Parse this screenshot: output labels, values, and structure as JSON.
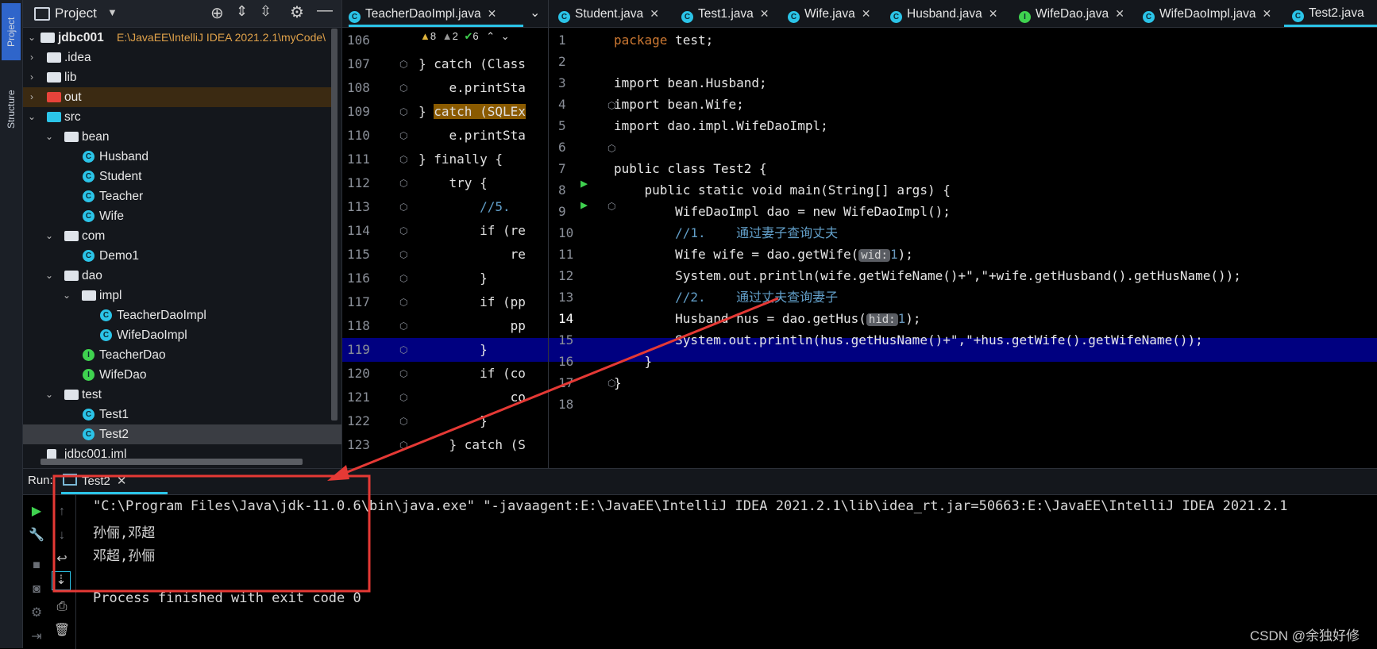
{
  "left_strip": {
    "project_label": "Project",
    "structure_label": "Structure"
  },
  "project": {
    "header_title": "Project",
    "root": {
      "name": "jdbc001",
      "path": "E:\\JavaEE\\IntelliJ IDEA 2021.2.1\\myCode\\"
    },
    "items": [
      {
        "label": ".idea"
      },
      {
        "label": "lib"
      },
      {
        "label": "out"
      },
      {
        "label": "src"
      },
      {
        "label": "bean"
      },
      {
        "label": "Husband"
      },
      {
        "label": "Student"
      },
      {
        "label": "Teacher"
      },
      {
        "label": "Wife"
      },
      {
        "label": "com"
      },
      {
        "label": "Demo1"
      },
      {
        "label": "dao"
      },
      {
        "label": "impl"
      },
      {
        "label": "TeacherDaoImpl"
      },
      {
        "label": "WifeDaoImpl"
      },
      {
        "label": "TeacherDao"
      },
      {
        "label": "WifeDao"
      },
      {
        "label": "test"
      },
      {
        "label": "Test1"
      },
      {
        "label": "Test2"
      },
      {
        "label": "jdbc001.iml"
      }
    ]
  },
  "editor1": {
    "tab": "TeacherDaoImpl.java",
    "inspections": {
      "warnings": "8",
      "weak": "2",
      "ok": "6"
    },
    "lines": [
      {
        "n": "106",
        "code": ""
      },
      {
        "n": "107",
        "code": "} catch (Class"
      },
      {
        "n": "108",
        "code": "    e.printSta"
      },
      {
        "n": "109",
        "code": "} catch (SQLEx"
      },
      {
        "n": "110",
        "code": "    e.printSta"
      },
      {
        "n": "111",
        "code": "} finally {"
      },
      {
        "n": "112",
        "code": "    try {"
      },
      {
        "n": "113",
        "code": "        //5."
      },
      {
        "n": "114",
        "code": "        if (re"
      },
      {
        "n": "115",
        "code": "            re"
      },
      {
        "n": "116",
        "code": "        }"
      },
      {
        "n": "117",
        "code": "        if (pp"
      },
      {
        "n": "118",
        "code": "            pp"
      },
      {
        "n": "119",
        "code": "        }"
      },
      {
        "n": "120",
        "code": "        if (co"
      },
      {
        "n": "121",
        "code": "            co"
      },
      {
        "n": "122",
        "code": "        }"
      },
      {
        "n": "123",
        "code": "    } catch (S"
      }
    ]
  },
  "editor2": {
    "tabs": [
      "Student.java",
      "Test1.java",
      "Wife.java",
      "Husband.java",
      "WifeDao.java",
      "WifeDaoImpl.java",
      "Test2.java"
    ],
    "line_numbers": [
      "1",
      "2",
      "3",
      "4",
      "5",
      "6",
      "7",
      "8",
      "9",
      "10",
      "11",
      "12",
      "13",
      "14",
      "15",
      "16",
      "17",
      "18"
    ],
    "code": {
      "l1": "package test;",
      "l3": "import bean.Husband;",
      "l4": "import bean.Wife;",
      "l5": "import dao.impl.WifeDaoImpl;",
      "l7": "public class Test2 {",
      "l8": "    public static void main(String[] args) {",
      "l9": "        WifeDaoImpl dao = new WifeDaoImpl();",
      "l10": "        //1.    通过妻子查询丈夫",
      "l11_a": "        Wife wife = dao.getWife(",
      "l11_hint": "wid:",
      "l11_num": "1",
      "l11_b": ");",
      "l12": "        System.out.println(wife.getWifeName()+\",\"+wife.getHusband().getHusName());",
      "l13": "        //2.    通过丈夫查询妻子",
      "l14_a": "        Husband hus = dao.getHus(",
      "l14_hint": "hid:",
      "l14_num": "1",
      "l14_b": ");",
      "l15": "        System.out.println(hus.getHusName()+\",\"+hus.getWife().getWifeName());",
      "l16": "    }",
      "l17": "}"
    }
  },
  "run": {
    "label": "Run:",
    "tab": "Test2",
    "output": [
      "\"C:\\Program Files\\Java\\jdk-11.0.6\\bin\\java.exe\" \"-javaagent:E:\\JavaEE\\IntelliJ IDEA 2021.2.1\\lib\\idea_rt.jar=50663:E:\\JavaEE\\IntelliJ IDEA 2021.2.1",
      "孙俪,邓超",
      "邓超,孙俪",
      "",
      "Process finished with exit code 0"
    ]
  },
  "watermark": "CSDN @余独好修",
  "colors": {
    "accent": "#2bc4e8",
    "selection": "#000080",
    "annotation": "#e53935",
    "keyword": "#cc7832"
  }
}
